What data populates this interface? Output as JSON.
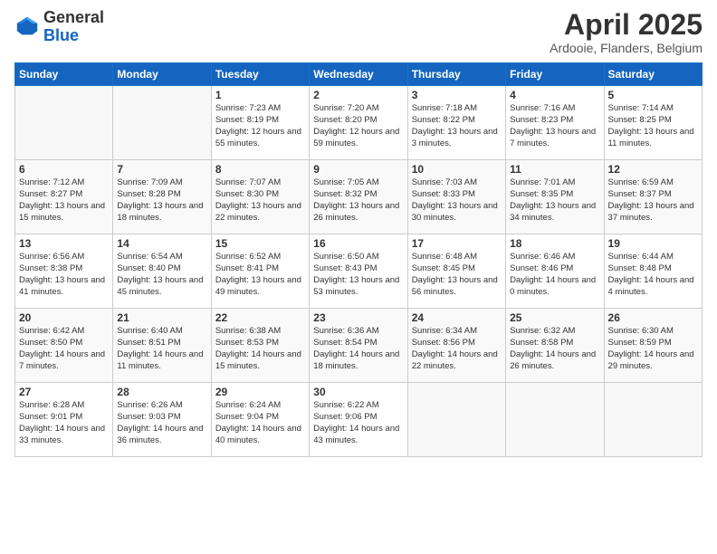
{
  "logo": {
    "general": "General",
    "blue": "Blue"
  },
  "header": {
    "month": "April 2025",
    "location": "Ardooie, Flanders, Belgium"
  },
  "weekdays": [
    "Sunday",
    "Monday",
    "Tuesday",
    "Wednesday",
    "Thursday",
    "Friday",
    "Saturday"
  ],
  "weeks": [
    [
      {
        "day": "",
        "sunrise": "",
        "sunset": "",
        "daylight": ""
      },
      {
        "day": "",
        "sunrise": "",
        "sunset": "",
        "daylight": ""
      },
      {
        "day": "1",
        "sunrise": "Sunrise: 7:23 AM",
        "sunset": "Sunset: 8:19 PM",
        "daylight": "Daylight: 12 hours and 55 minutes."
      },
      {
        "day": "2",
        "sunrise": "Sunrise: 7:20 AM",
        "sunset": "Sunset: 8:20 PM",
        "daylight": "Daylight: 12 hours and 59 minutes."
      },
      {
        "day": "3",
        "sunrise": "Sunrise: 7:18 AM",
        "sunset": "Sunset: 8:22 PM",
        "daylight": "Daylight: 13 hours and 3 minutes."
      },
      {
        "day": "4",
        "sunrise": "Sunrise: 7:16 AM",
        "sunset": "Sunset: 8:23 PM",
        "daylight": "Daylight: 13 hours and 7 minutes."
      },
      {
        "day": "5",
        "sunrise": "Sunrise: 7:14 AM",
        "sunset": "Sunset: 8:25 PM",
        "daylight": "Daylight: 13 hours and 11 minutes."
      }
    ],
    [
      {
        "day": "6",
        "sunrise": "Sunrise: 7:12 AM",
        "sunset": "Sunset: 8:27 PM",
        "daylight": "Daylight: 13 hours and 15 minutes."
      },
      {
        "day": "7",
        "sunrise": "Sunrise: 7:09 AM",
        "sunset": "Sunset: 8:28 PM",
        "daylight": "Daylight: 13 hours and 18 minutes."
      },
      {
        "day": "8",
        "sunrise": "Sunrise: 7:07 AM",
        "sunset": "Sunset: 8:30 PM",
        "daylight": "Daylight: 13 hours and 22 minutes."
      },
      {
        "day": "9",
        "sunrise": "Sunrise: 7:05 AM",
        "sunset": "Sunset: 8:32 PM",
        "daylight": "Daylight: 13 hours and 26 minutes."
      },
      {
        "day": "10",
        "sunrise": "Sunrise: 7:03 AM",
        "sunset": "Sunset: 8:33 PM",
        "daylight": "Daylight: 13 hours and 30 minutes."
      },
      {
        "day": "11",
        "sunrise": "Sunrise: 7:01 AM",
        "sunset": "Sunset: 8:35 PM",
        "daylight": "Daylight: 13 hours and 34 minutes."
      },
      {
        "day": "12",
        "sunrise": "Sunrise: 6:59 AM",
        "sunset": "Sunset: 8:37 PM",
        "daylight": "Daylight: 13 hours and 37 minutes."
      }
    ],
    [
      {
        "day": "13",
        "sunrise": "Sunrise: 6:56 AM",
        "sunset": "Sunset: 8:38 PM",
        "daylight": "Daylight: 13 hours and 41 minutes."
      },
      {
        "day": "14",
        "sunrise": "Sunrise: 6:54 AM",
        "sunset": "Sunset: 8:40 PM",
        "daylight": "Daylight: 13 hours and 45 minutes."
      },
      {
        "day": "15",
        "sunrise": "Sunrise: 6:52 AM",
        "sunset": "Sunset: 8:41 PM",
        "daylight": "Daylight: 13 hours and 49 minutes."
      },
      {
        "day": "16",
        "sunrise": "Sunrise: 6:50 AM",
        "sunset": "Sunset: 8:43 PM",
        "daylight": "Daylight: 13 hours and 53 minutes."
      },
      {
        "day": "17",
        "sunrise": "Sunrise: 6:48 AM",
        "sunset": "Sunset: 8:45 PM",
        "daylight": "Daylight: 13 hours and 56 minutes."
      },
      {
        "day": "18",
        "sunrise": "Sunrise: 6:46 AM",
        "sunset": "Sunset: 8:46 PM",
        "daylight": "Daylight: 14 hours and 0 minutes."
      },
      {
        "day": "19",
        "sunrise": "Sunrise: 6:44 AM",
        "sunset": "Sunset: 8:48 PM",
        "daylight": "Daylight: 14 hours and 4 minutes."
      }
    ],
    [
      {
        "day": "20",
        "sunrise": "Sunrise: 6:42 AM",
        "sunset": "Sunset: 8:50 PM",
        "daylight": "Daylight: 14 hours and 7 minutes."
      },
      {
        "day": "21",
        "sunrise": "Sunrise: 6:40 AM",
        "sunset": "Sunset: 8:51 PM",
        "daylight": "Daylight: 14 hours and 11 minutes."
      },
      {
        "day": "22",
        "sunrise": "Sunrise: 6:38 AM",
        "sunset": "Sunset: 8:53 PM",
        "daylight": "Daylight: 14 hours and 15 minutes."
      },
      {
        "day": "23",
        "sunrise": "Sunrise: 6:36 AM",
        "sunset": "Sunset: 8:54 PM",
        "daylight": "Daylight: 14 hours and 18 minutes."
      },
      {
        "day": "24",
        "sunrise": "Sunrise: 6:34 AM",
        "sunset": "Sunset: 8:56 PM",
        "daylight": "Daylight: 14 hours and 22 minutes."
      },
      {
        "day": "25",
        "sunrise": "Sunrise: 6:32 AM",
        "sunset": "Sunset: 8:58 PM",
        "daylight": "Daylight: 14 hours and 26 minutes."
      },
      {
        "day": "26",
        "sunrise": "Sunrise: 6:30 AM",
        "sunset": "Sunset: 8:59 PM",
        "daylight": "Daylight: 14 hours and 29 minutes."
      }
    ],
    [
      {
        "day": "27",
        "sunrise": "Sunrise: 6:28 AM",
        "sunset": "Sunset: 9:01 PM",
        "daylight": "Daylight: 14 hours and 33 minutes."
      },
      {
        "day": "28",
        "sunrise": "Sunrise: 6:26 AM",
        "sunset": "Sunset: 9:03 PM",
        "daylight": "Daylight: 14 hours and 36 minutes."
      },
      {
        "day": "29",
        "sunrise": "Sunrise: 6:24 AM",
        "sunset": "Sunset: 9:04 PM",
        "daylight": "Daylight: 14 hours and 40 minutes."
      },
      {
        "day": "30",
        "sunrise": "Sunrise: 6:22 AM",
        "sunset": "Sunset: 9:06 PM",
        "daylight": "Daylight: 14 hours and 43 minutes."
      },
      {
        "day": "",
        "sunrise": "",
        "sunset": "",
        "daylight": ""
      },
      {
        "day": "",
        "sunrise": "",
        "sunset": "",
        "daylight": ""
      },
      {
        "day": "",
        "sunrise": "",
        "sunset": "",
        "daylight": ""
      }
    ]
  ]
}
